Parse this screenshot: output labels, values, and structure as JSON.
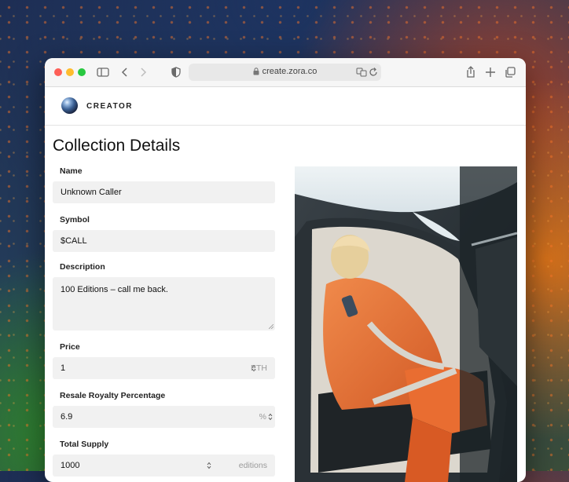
{
  "browser": {
    "url": "create.zora.co"
  },
  "site": {
    "brand": "CREATOR"
  },
  "page": {
    "title": "Collection Details"
  },
  "form": {
    "name_label": "Name",
    "name_value": "Unknown Caller",
    "symbol_label": "Symbol",
    "symbol_value": "$CALL",
    "description_label": "Description",
    "description_value": "100 Editions – call me back.",
    "price_label": "Price",
    "price_value": "1",
    "price_unit": "ETH",
    "royalty_label": "Resale Royalty Percentage",
    "royalty_value": "6.9",
    "royalty_unit": "%",
    "supply_label": "Total Supply",
    "supply_value": "1000",
    "supply_unit": "editions"
  },
  "icons": {
    "sidebar": "sidebar-icon",
    "back": "chevron-left-icon",
    "forward": "chevron-right-icon",
    "privacy": "shield-icon",
    "lock": "lock-icon",
    "translate": "translate-icon",
    "reload": "reload-icon",
    "share": "share-icon",
    "new_tab": "plus-icon",
    "tabs": "tabs-overview-icon"
  },
  "colors": {
    "close": "#fe5f57",
    "minimize": "#febc2e",
    "zoom": "#28c840",
    "jacket": "#e9733a"
  }
}
